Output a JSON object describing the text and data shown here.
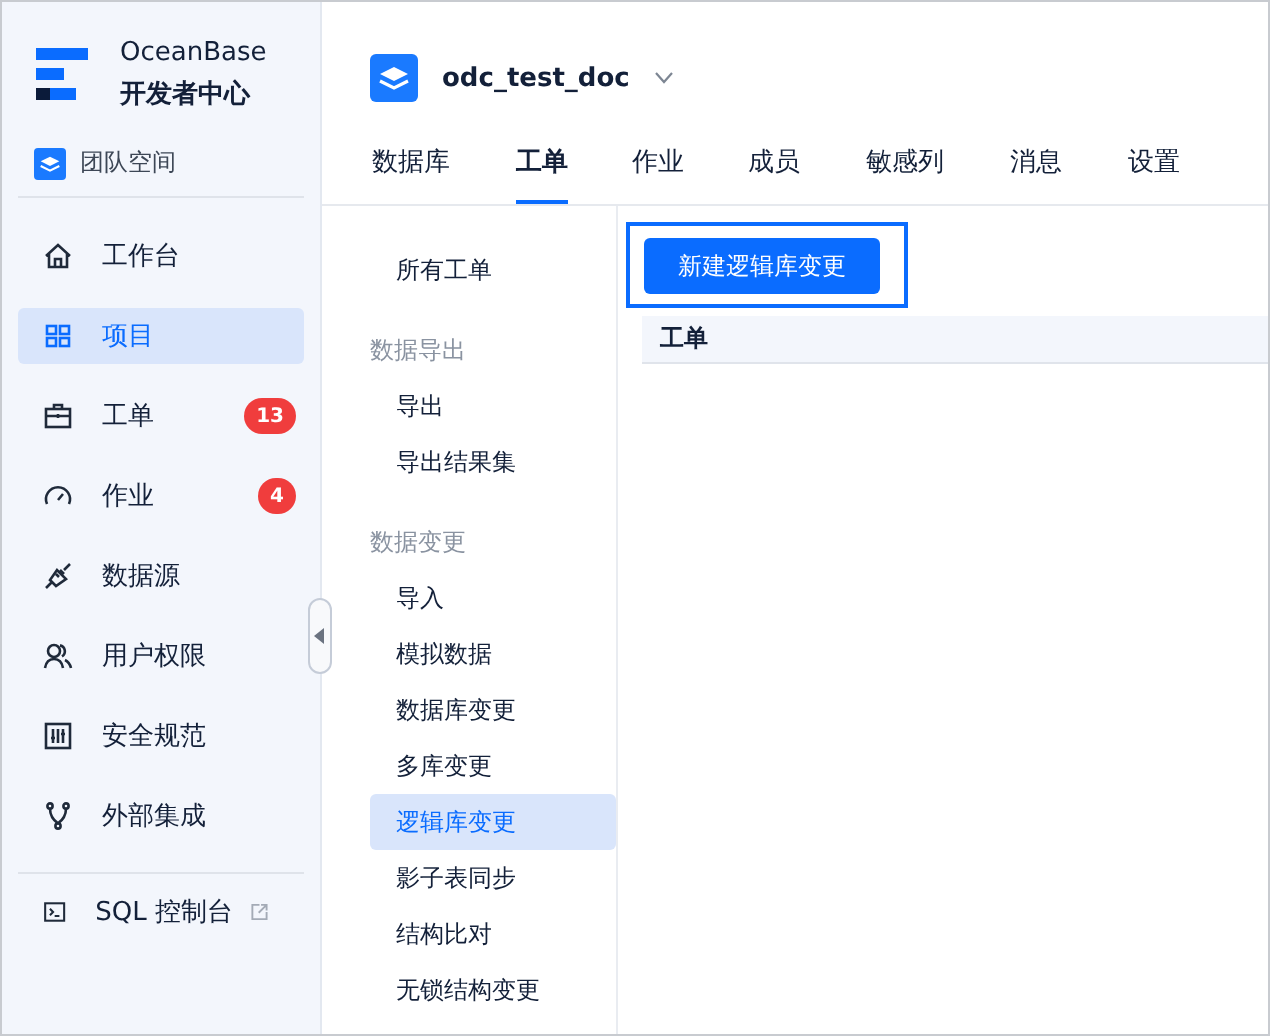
{
  "brand": {
    "name": "OceanBase",
    "subtitle": "开发者中心"
  },
  "space": {
    "label": "团队空间"
  },
  "nav": [
    {
      "label": "工作台",
      "selected": false
    },
    {
      "label": "项目",
      "selected": true
    },
    {
      "label": "工单",
      "selected": false,
      "badge": "13"
    },
    {
      "label": "作业",
      "selected": false,
      "badge": "4"
    },
    {
      "label": "数据源",
      "selected": false
    },
    {
      "label": "用户权限",
      "selected": false
    },
    {
      "label": "安全规范",
      "selected": false
    },
    {
      "label": "外部集成",
      "selected": false
    }
  ],
  "console": {
    "label": "SQL 控制台"
  },
  "project": {
    "name": "odc_test_doc"
  },
  "tabs": [
    {
      "label": "数据库",
      "selected": false
    },
    {
      "label": "工单",
      "selected": true
    },
    {
      "label": "作业",
      "selected": false
    },
    {
      "label": "成员",
      "selected": false
    },
    {
      "label": "敏感列",
      "selected": false
    },
    {
      "label": "消息",
      "selected": false
    },
    {
      "label": "设置",
      "selected": false
    }
  ],
  "submenu": [
    {
      "kind": "item",
      "label": "所有工单",
      "selected": false
    },
    {
      "kind": "heading",
      "label": "数据导出"
    },
    {
      "kind": "item",
      "label": "导出",
      "selected": false
    },
    {
      "kind": "item",
      "label": "导出结果集",
      "selected": false
    },
    {
      "kind": "heading",
      "label": "数据变更"
    },
    {
      "kind": "item",
      "label": "导入",
      "selected": false
    },
    {
      "kind": "item",
      "label": "模拟数据",
      "selected": false
    },
    {
      "kind": "item",
      "label": "数据库变更",
      "selected": false
    },
    {
      "kind": "item",
      "label": "多库变更",
      "selected": false
    },
    {
      "kind": "item",
      "label": "逻辑库变更",
      "selected": true
    },
    {
      "kind": "item",
      "label": "影子表同步",
      "selected": false
    },
    {
      "kind": "item",
      "label": "结构比对",
      "selected": false
    },
    {
      "kind": "item",
      "label": "无锁结构变更",
      "selected": false
    }
  ],
  "action": {
    "label": "新建逻辑库变更"
  },
  "table": {
    "columns": [
      "工单"
    ]
  }
}
